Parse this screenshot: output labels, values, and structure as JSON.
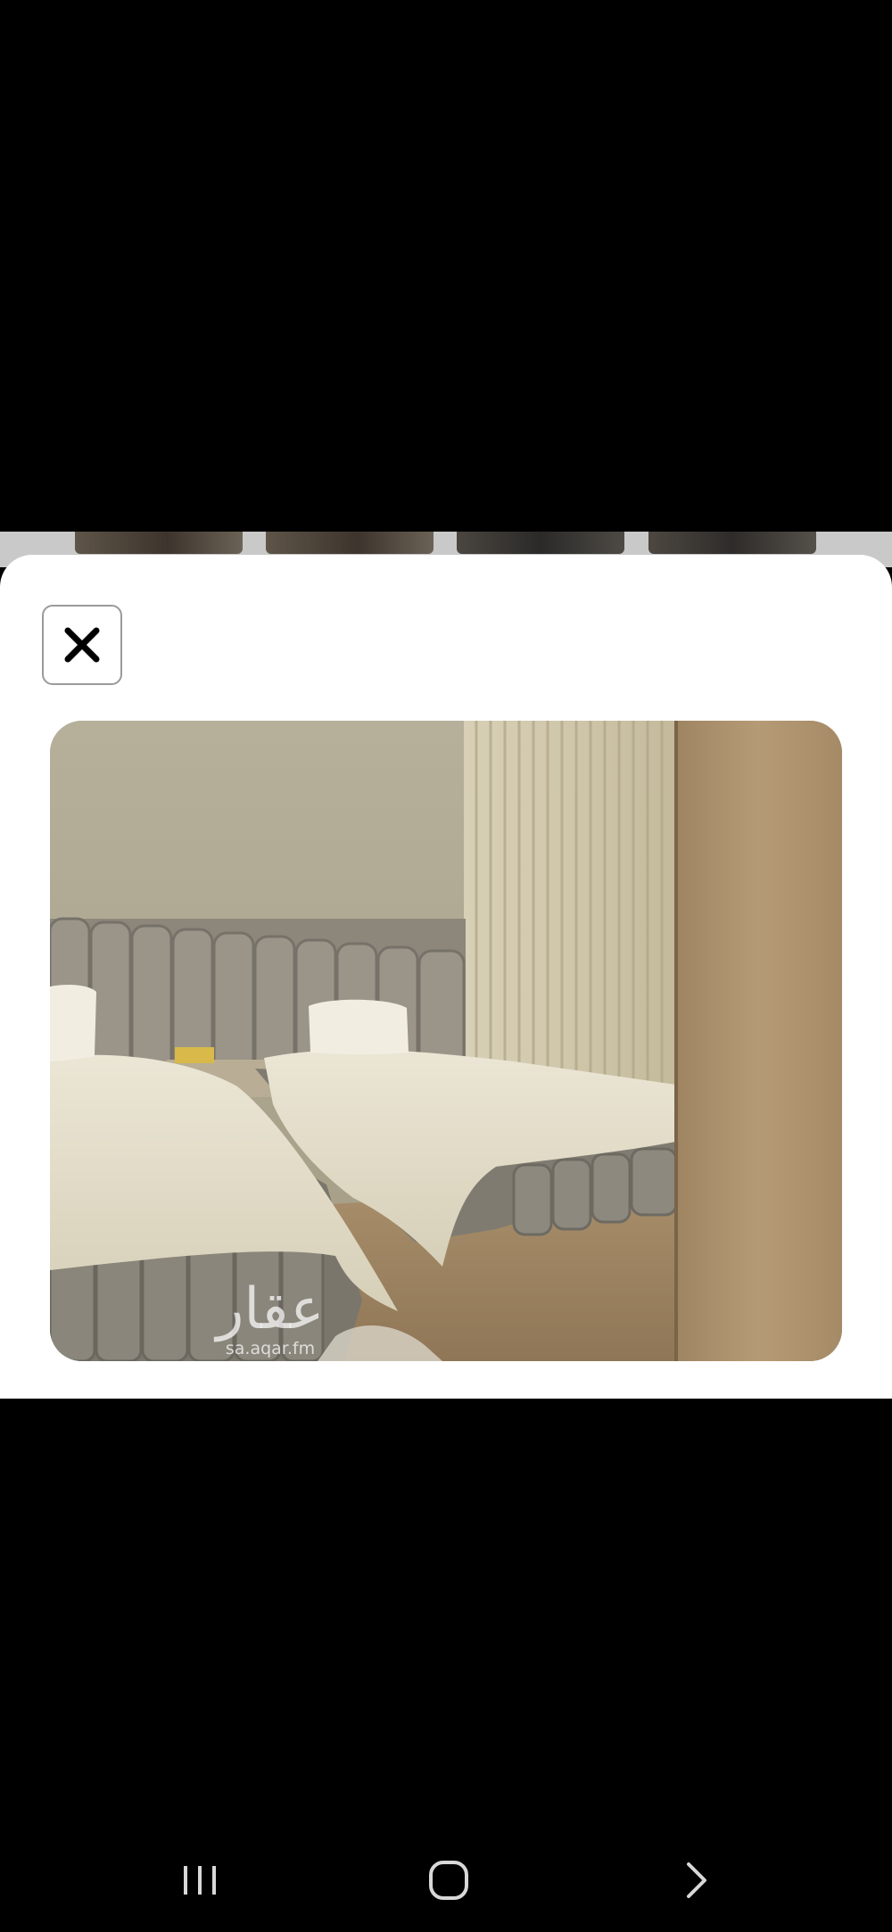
{
  "modal": {
    "close_label": "✕"
  },
  "photo": {
    "watermark_logo": "عقار",
    "watermark_url": "sa.aqar.fm"
  },
  "icons": {
    "close": "close-icon",
    "recent_apps": "recent-apps-icon",
    "home": "home-icon",
    "back": "back-icon"
  },
  "colors": {
    "sheet_background": "#ffffff",
    "screen_background": "#000000",
    "close_border": "#9a9a9a"
  }
}
